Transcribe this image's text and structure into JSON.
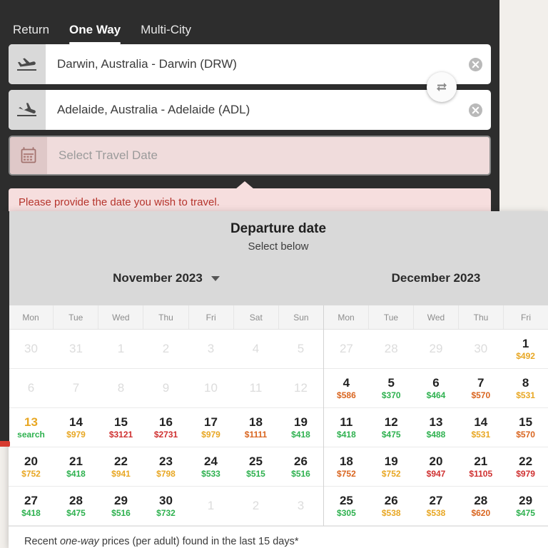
{
  "theme": {
    "panel_bg": "#2d2d2d",
    "page_bg": "#f2efeb",
    "error_bg": "#f6dede",
    "error_text": "#b5342c",
    "price_green": "#2eb14f",
    "price_orange": "#e8a723",
    "price_red": "#cf3030"
  },
  "tabs": [
    {
      "label": "Return",
      "active": false
    },
    {
      "label": "One Way",
      "active": true
    },
    {
      "label": "Multi-City",
      "active": false
    }
  ],
  "fields": {
    "origin": {
      "value": "Darwin, Australia - Darwin (DRW)",
      "icon": "plane-takeoff-icon",
      "clear": "clear-icon"
    },
    "destination": {
      "value": "Adelaide, Australia - Adelaide (ADL)",
      "icon": "plane-landing-icon",
      "clear": "clear-icon"
    },
    "date": {
      "placeholder": "Select Travel Date",
      "value": "",
      "icon": "calendar-icon"
    },
    "swap": "swap-icon"
  },
  "error": {
    "message": "Please provide the date you wish to travel."
  },
  "calendar": {
    "title": "Departure date",
    "subtitle": "Select below",
    "footer_prefix": "Recent ",
    "footer_italic": "one-way",
    "footer_suffix": " prices (per adult) found in the last 15 days*",
    "months": [
      {
        "label": "November 2023",
        "has_dropdown": true,
        "dow": [
          "Mon",
          "Tue",
          "Wed",
          "Thu",
          "Fri",
          "Sat",
          "Sun"
        ],
        "weeks": [
          [
            {
              "num": "30",
              "muted": true
            },
            {
              "num": "31",
              "muted": true
            },
            {
              "num": "1",
              "muted": true
            },
            {
              "num": "2",
              "muted": true
            },
            {
              "num": "3",
              "muted": true
            },
            {
              "num": "4",
              "muted": true
            },
            {
              "num": "5",
              "muted": true
            }
          ],
          [
            {
              "num": "6",
              "muted": true
            },
            {
              "num": "7",
              "muted": true
            },
            {
              "num": "8",
              "muted": true
            },
            {
              "num": "9",
              "muted": true
            },
            {
              "num": "10",
              "muted": true
            },
            {
              "num": "11",
              "muted": true
            },
            {
              "num": "12",
              "muted": true
            }
          ],
          [
            {
              "num": "13",
              "price": "search",
              "price_color": "green",
              "num_color": "orange"
            },
            {
              "num": "14",
              "price": "$979",
              "price_color": "orange"
            },
            {
              "num": "15",
              "price": "$3121",
              "price_color": "red"
            },
            {
              "num": "16",
              "price": "$2731",
              "price_color": "red"
            },
            {
              "num": "17",
              "price": "$979",
              "price_color": "orange"
            },
            {
              "num": "18",
              "price": "$1111",
              "price_color": "dark"
            },
            {
              "num": "19",
              "price": "$418",
              "price_color": "green"
            }
          ],
          [
            {
              "num": "20",
              "price": "$752",
              "price_color": "orange"
            },
            {
              "num": "21",
              "price": "$418",
              "price_color": "green"
            },
            {
              "num": "22",
              "price": "$941",
              "price_color": "orange"
            },
            {
              "num": "23",
              "price": "$798",
              "price_color": "orange"
            },
            {
              "num": "24",
              "price": "$533",
              "price_color": "green"
            },
            {
              "num": "25",
              "price": "$515",
              "price_color": "green"
            },
            {
              "num": "26",
              "price": "$516",
              "price_color": "green"
            }
          ],
          [
            {
              "num": "27",
              "price": "$418",
              "price_color": "green"
            },
            {
              "num": "28",
              "price": "$475",
              "price_color": "green"
            },
            {
              "num": "29",
              "price": "$516",
              "price_color": "green"
            },
            {
              "num": "30",
              "price": "$732",
              "price_color": "green"
            },
            {
              "num": "1",
              "muted": true
            },
            {
              "num": "2",
              "muted": true
            },
            {
              "num": "3",
              "muted": true
            }
          ]
        ]
      },
      {
        "label": "December 2023",
        "has_dropdown": false,
        "dow": [
          "Mon",
          "Tue",
          "Wed",
          "Thu",
          "Fri"
        ],
        "weeks": [
          [
            {
              "num": "27",
              "muted": true
            },
            {
              "num": "28",
              "muted": true
            },
            {
              "num": "29",
              "muted": true
            },
            {
              "num": "30",
              "muted": true
            },
            {
              "num": "1",
              "price": "$492",
              "price_color": "orange"
            }
          ],
          [
            {
              "num": "4",
              "price": "$586",
              "price_color": "dark"
            },
            {
              "num": "5",
              "price": "$370",
              "price_color": "green"
            },
            {
              "num": "6",
              "price": "$464",
              "price_color": "green"
            },
            {
              "num": "7",
              "price": "$570",
              "price_color": "dark"
            },
            {
              "num": "8",
              "price": "$531",
              "price_color": "orange"
            }
          ],
          [
            {
              "num": "11",
              "price": "$418",
              "price_color": "green"
            },
            {
              "num": "12",
              "price": "$475",
              "price_color": "green"
            },
            {
              "num": "13",
              "price": "$488",
              "price_color": "green"
            },
            {
              "num": "14",
              "price": "$531",
              "price_color": "orange"
            },
            {
              "num": "15",
              "price": "$570",
              "price_color": "dark"
            }
          ],
          [
            {
              "num": "18",
              "price": "$752",
              "price_color": "dark"
            },
            {
              "num": "19",
              "price": "$752",
              "price_color": "orange"
            },
            {
              "num": "20",
              "price": "$947",
              "price_color": "red"
            },
            {
              "num": "21",
              "price": "$1105",
              "price_color": "red"
            },
            {
              "num": "22",
              "price": "$979",
              "price_color": "red"
            }
          ],
          [
            {
              "num": "25",
              "price": "$305",
              "price_color": "green"
            },
            {
              "num": "26",
              "price": "$538",
              "price_color": "orange"
            },
            {
              "num": "27",
              "price": "$538",
              "price_color": "orange"
            },
            {
              "num": "28",
              "price": "$620",
              "price_color": "dark"
            },
            {
              "num": "29",
              "price": "$475",
              "price_color": "green"
            }
          ]
        ]
      }
    ]
  }
}
